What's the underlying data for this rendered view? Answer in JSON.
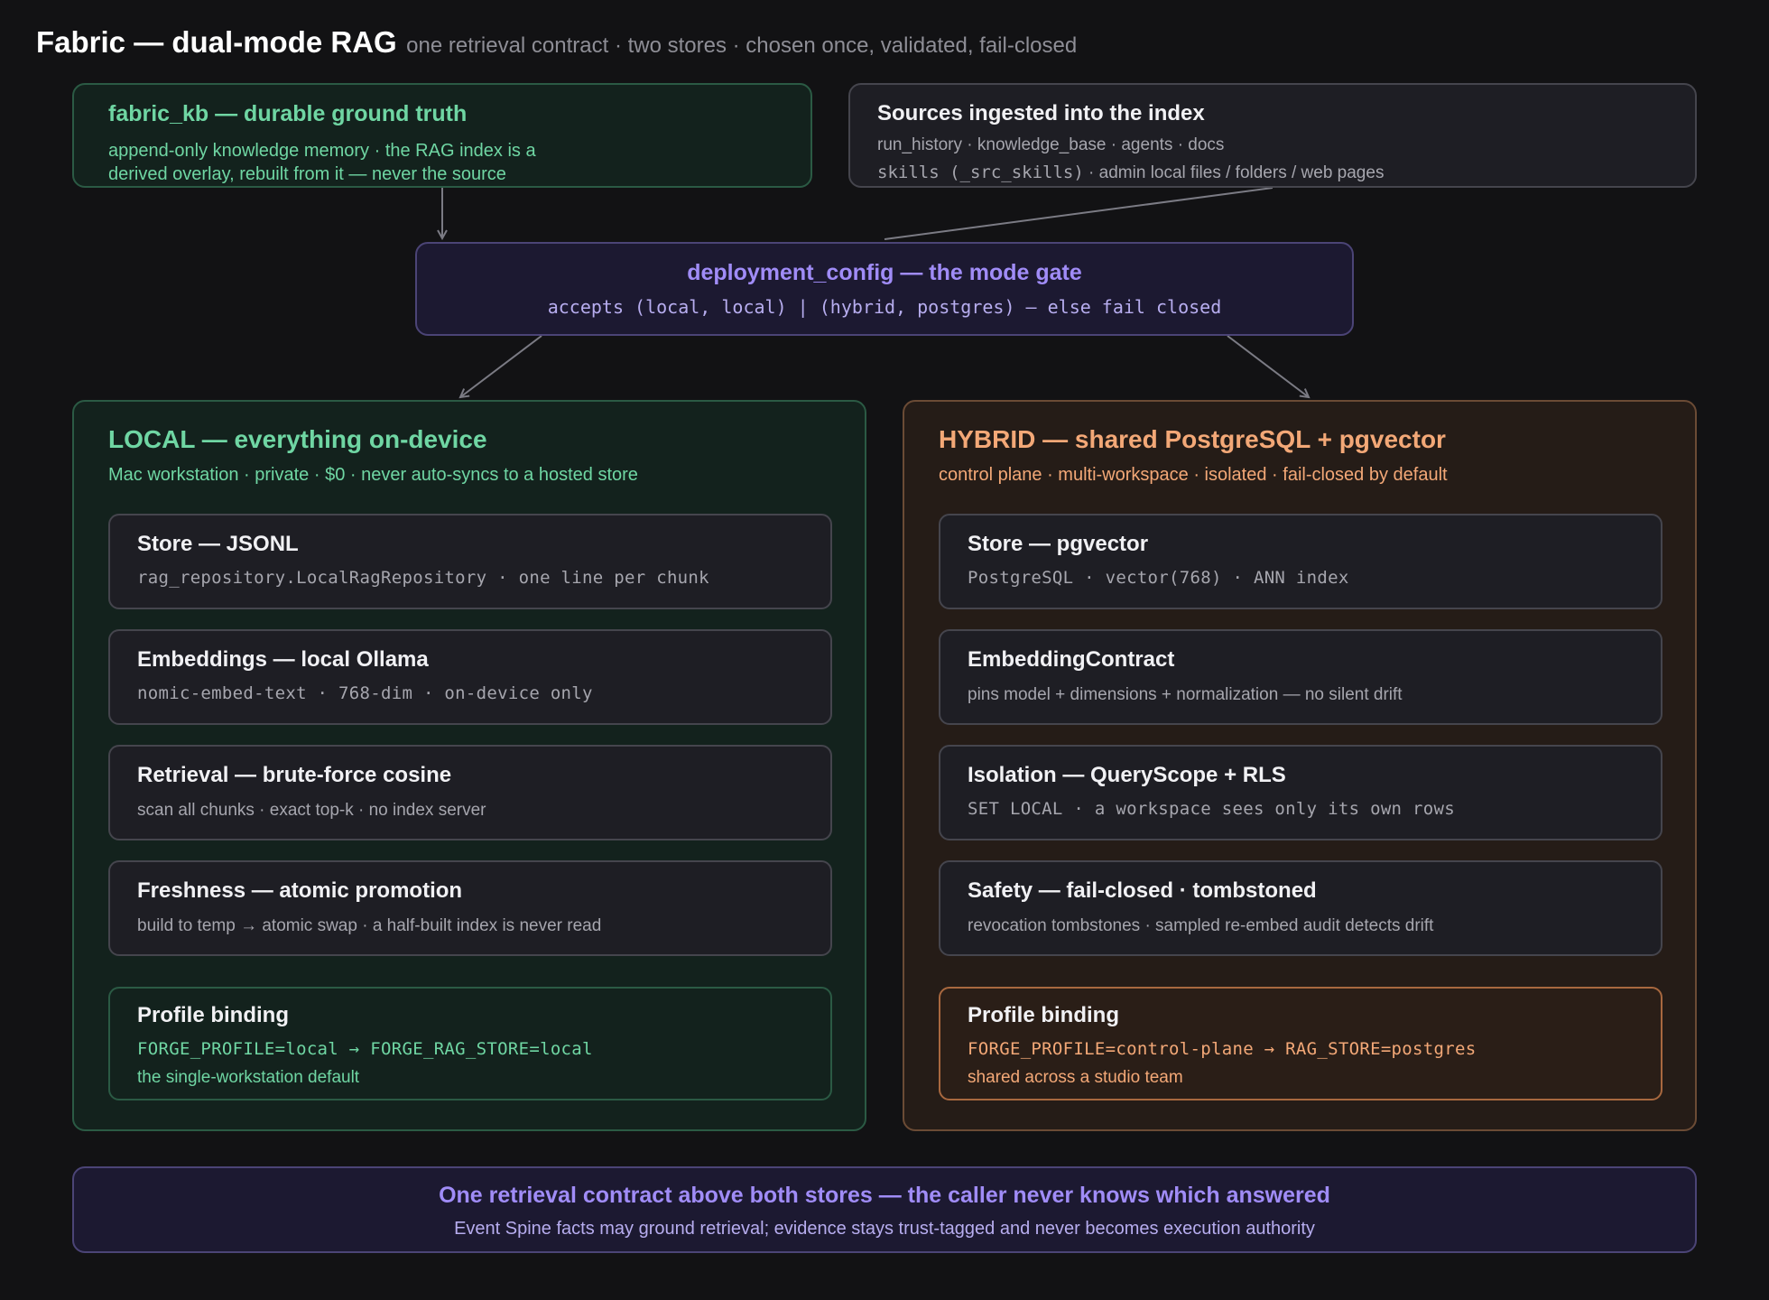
{
  "header": {
    "title": "Fabric — dual-mode RAG",
    "subtitle": "one retrieval contract · two stores · chosen once, validated, fail-closed"
  },
  "kb_box": {
    "title": "fabric_kb — durable ground truth",
    "line1": "append-only knowledge memory · the RAG index is a",
    "line2": "derived overlay, rebuilt from it — never the source"
  },
  "sources_box": {
    "title": "Sources ingested into the index",
    "line1": "run_history · knowledge_base · agents · docs",
    "line2_code": "skills (_src_skills)",
    "line2_rest": " · admin local files / folders / web pages"
  },
  "gate": {
    "title": "deployment_config — the mode gate",
    "rule": "accepts (local, local) | (hybrid, postgres) — else fail closed"
  },
  "local": {
    "title": "LOCAL — everything on-device",
    "subtitle": "Mac workstation · private · $0 · never auto-syncs to a hosted store",
    "cards": [
      {
        "title": "Store — JSONL",
        "detail": "rag_repository.LocalRagRepository · one line per chunk"
      },
      {
        "title": "Embeddings — local Ollama",
        "detail": "nomic-embed-text · 768-dim · on-device only"
      },
      {
        "title": "Retrieval — brute-force cosine",
        "detail": "scan all chunks · exact top-k · no index server"
      },
      {
        "title": "Freshness — atomic promotion",
        "detail": "build to temp → atomic swap · a half-built index is never read"
      }
    ],
    "profile": {
      "title": "Profile binding",
      "code": "FORGE_PROFILE=local → FORGE_RAG_STORE=local",
      "note": "the single-workstation default"
    }
  },
  "hybrid": {
    "title": "HYBRID — shared PostgreSQL + pgvector",
    "subtitle": "control plane · multi-workspace · isolated · fail-closed by default",
    "cards": [
      {
        "title": "Store — pgvector",
        "detail": "PostgreSQL · vector(768) · ANN index"
      },
      {
        "title": "EmbeddingContract",
        "detail": "pins model + dimensions + normalization — no silent drift"
      },
      {
        "title": "Isolation — QueryScope + RLS",
        "detail": "SET LOCAL · a workspace sees only its own rows"
      },
      {
        "title": "Safety — fail-closed · tombstoned",
        "detail": "revocation tombstones · sampled re-embed audit detects drift"
      }
    ],
    "profile": {
      "title": "Profile binding",
      "code": "FORGE_PROFILE=control-plane → RAG_STORE=postgres",
      "note": "shared across a studio team"
    }
  },
  "footer": {
    "title": "One retrieval contract above both stores — the caller never knows which answered",
    "note": "Event Spine facts may ground retrieval; evidence stays trust-tagged and never becomes execution authority"
  },
  "colors": {
    "background": "#121214",
    "green_accent": "#6fd6a3",
    "orange_accent": "#f3a877",
    "purple_accent": "#a08cf7",
    "connector": "#7b7b84"
  }
}
